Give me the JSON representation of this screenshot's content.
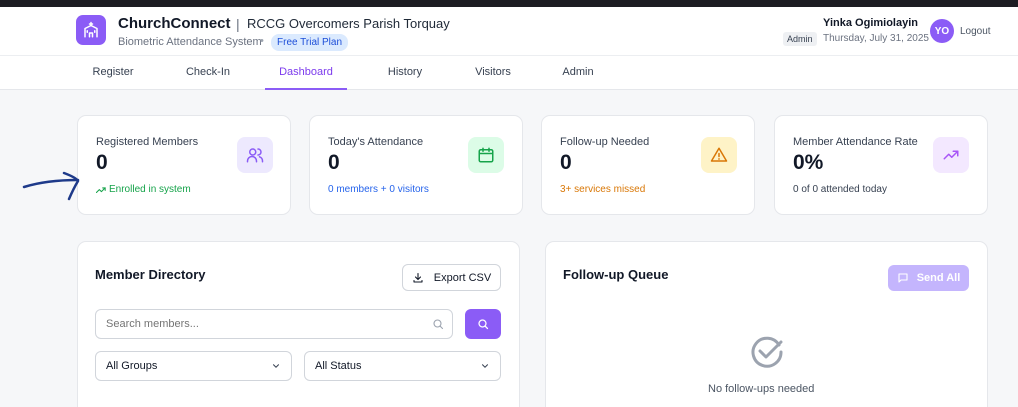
{
  "header": {
    "app_name": "ChurchConnect",
    "separator": "|",
    "parish_name": "RCCG Overcomers Parish Torquay",
    "subtitle": "Biometric Attendance System",
    "dot": "•",
    "plan_badge": "Free Trial Plan",
    "user_name": "Yinka Ogimiolayin",
    "role_badge": "Admin",
    "date": "Thursday, July 31, 2025",
    "avatar_initials": "YO",
    "logout_label": "Logout"
  },
  "nav": {
    "tabs": [
      {
        "label": "Register"
      },
      {
        "label": "Check-In"
      },
      {
        "label": "Dashboard",
        "active": true
      },
      {
        "label": "History"
      },
      {
        "label": "Visitors"
      },
      {
        "label": "Admin"
      }
    ]
  },
  "stats": [
    {
      "label": "Registered Members",
      "value": "0",
      "note": "Enrolled in system",
      "note_color": "#16a34a",
      "icon": "users-icon",
      "accent": "#8b5cf6"
    },
    {
      "label": "Today's Attendance",
      "value": "0",
      "note": "0 members + 0 visitors",
      "note_color": "#2563eb",
      "icon": "calendar-icon",
      "accent": "#16a34a"
    },
    {
      "label": "Follow-up Needed",
      "value": "0",
      "note": "3+ services missed",
      "note_color": "#d97706",
      "icon": "warning-icon",
      "accent": "#d97706"
    },
    {
      "label": "Member Attendance Rate",
      "value": "0%",
      "note": "0 of 0 attended today",
      "note_color": "#374151",
      "icon": "trending-up-icon",
      "accent": "#8b5cf6"
    }
  ],
  "directory": {
    "title": "Member Directory",
    "export_label": "Export CSV",
    "search_placeholder": "Search members...",
    "group_filter": "All Groups",
    "status_filter": "All Status"
  },
  "followup": {
    "title": "Follow-up Queue",
    "send_all_label": "Send All",
    "empty_text": "No follow-ups needed"
  },
  "colors": {
    "accent": "#8b5cf6",
    "accent_light": "#c4b5fd",
    "border": "#e5e7eb",
    "background": "#f6f7f9"
  }
}
